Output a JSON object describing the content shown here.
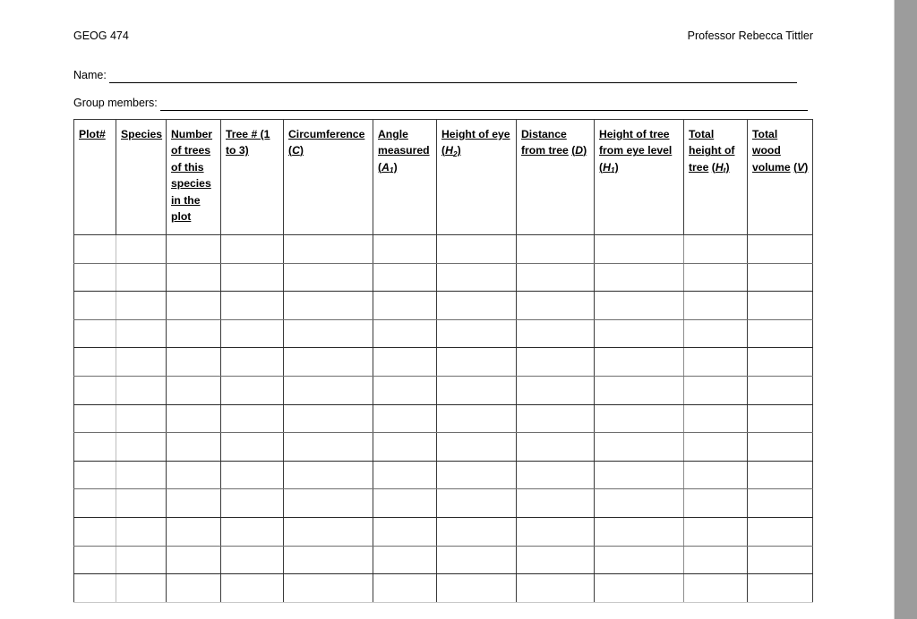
{
  "document": {
    "course_code": "GEOG 474",
    "instructor": "Professor Rebecca Tittler",
    "fields": [
      {
        "label": "Name:",
        "value": ""
      },
      {
        "label": "Group members:",
        "value": ""
      }
    ]
  },
  "table": {
    "columns": [
      {
        "id": "plot",
        "header": "Plot#",
        "symbol": ""
      },
      {
        "id": "species",
        "header": "Species",
        "symbol": ""
      },
      {
        "id": "num_trees",
        "header": "Number of trees of this species in the plot",
        "symbol": ""
      },
      {
        "id": "tree_num",
        "header": "Tree # (1 to 3)",
        "symbol": ""
      },
      {
        "id": "circumference",
        "header": "Circumference",
        "symbol": "C"
      },
      {
        "id": "angle",
        "header": "Angle measured",
        "symbol": "A1"
      },
      {
        "id": "height_of_eye",
        "header": "Height of eye",
        "symbol": "H2"
      },
      {
        "id": "distance",
        "header": "Distance from tree",
        "symbol": "D"
      },
      {
        "id": "height_eye_level",
        "header": "Height of tree from eye level",
        "symbol": "H1"
      },
      {
        "id": "total_height",
        "header": "Total height of tree",
        "symbol": "Ht"
      },
      {
        "id": "wood_volume",
        "header": "Total wood volume",
        "symbol": "V"
      }
    ],
    "row_count": 13,
    "rows": [
      [
        "",
        "",
        "",
        "",
        "",
        "",
        "",
        "",
        "",
        "",
        ""
      ],
      [
        "",
        "",
        "",
        "",
        "",
        "",
        "",
        "",
        "",
        "",
        ""
      ],
      [
        "",
        "",
        "",
        "",
        "",
        "",
        "",
        "",
        "",
        "",
        ""
      ],
      [
        "",
        "",
        "",
        "",
        "",
        "",
        "",
        "",
        "",
        "",
        ""
      ],
      [
        "",
        "",
        "",
        "",
        "",
        "",
        "",
        "",
        "",
        "",
        ""
      ],
      [
        "",
        "",
        "",
        "",
        "",
        "",
        "",
        "",
        "",
        "",
        ""
      ],
      [
        "",
        "",
        "",
        "",
        "",
        "",
        "",
        "",
        "",
        "",
        ""
      ],
      [
        "",
        "",
        "",
        "",
        "",
        "",
        "",
        "",
        "",
        "",
        ""
      ],
      [
        "",
        "",
        "",
        "",
        "",
        "",
        "",
        "",
        "",
        "",
        ""
      ],
      [
        "",
        "",
        "",
        "",
        "",
        "",
        "",
        "",
        "",
        "",
        ""
      ],
      [
        "",
        "",
        "",
        "",
        "",
        "",
        "",
        "",
        "",
        "",
        ""
      ],
      [
        "",
        "",
        "",
        "",
        "",
        "",
        "",
        "",
        "",
        "",
        ""
      ],
      [
        "",
        "",
        "",
        "",
        "",
        "",
        "",
        "",
        "",
        "",
        ""
      ]
    ]
  },
  "viewer": {
    "scrollbar_track_color": "#9c9c9c",
    "page_background": "#ffffff"
  }
}
